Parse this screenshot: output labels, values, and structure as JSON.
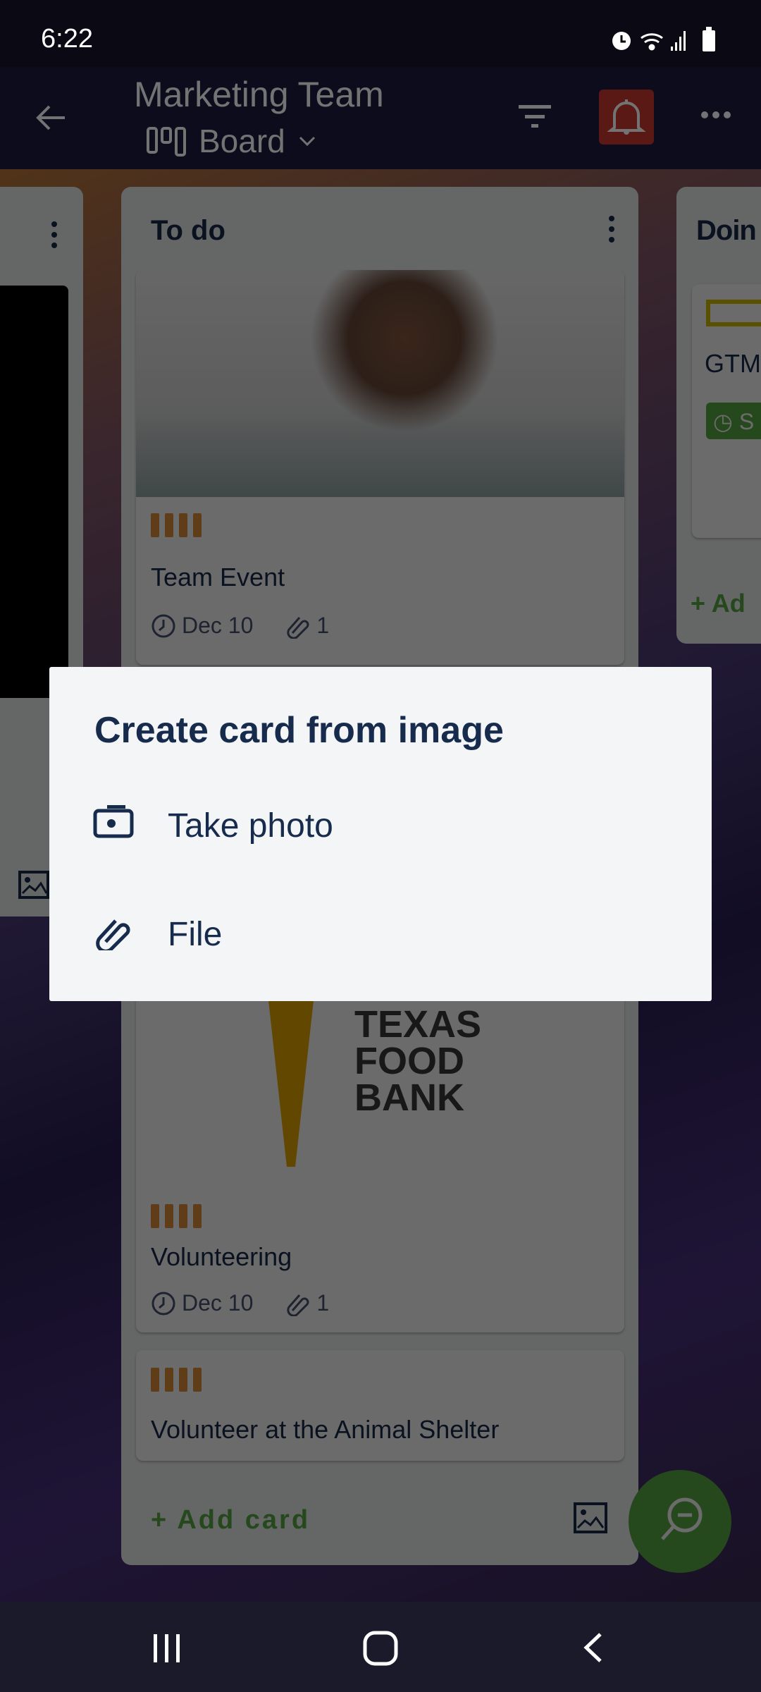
{
  "status_bar": {
    "time": "6:22",
    "icons": [
      "alarm-icon",
      "wifi-icon",
      "signal-icon",
      "battery-icon"
    ]
  },
  "app_bar": {
    "title": "Marketing Team",
    "view": "Board",
    "icons": [
      "back-arrow-icon",
      "board-icon",
      "chevron-down-icon",
      "filter-icon",
      "bell-icon",
      "more-icon"
    ],
    "bell_color": "#c9372c"
  },
  "lists": [
    {
      "title": "To do",
      "cards": [
        {
          "title": "Team Event",
          "due": "Dec 10",
          "attachments": "1",
          "label_color": "#e2913a"
        },
        {
          "image_text": "TEXAS FOOD BANK",
          "title": "Volunteering",
          "due": "Dec 10",
          "attachments": "1",
          "label_color": "#e2913a"
        },
        {
          "title": "Volunteer at the Animal Shelter",
          "label_color": "#e2913a"
        }
      ],
      "add_card": "+ Add card"
    },
    {
      "title": "Doin",
      "cards": [
        {
          "title": "GTM",
          "badge": "S"
        }
      ],
      "add_card": "+ Ad"
    }
  ],
  "dialog": {
    "title": "Create card from image",
    "items": [
      {
        "label": "Take photo",
        "icon": "camera-icon"
      },
      {
        "label": "File",
        "icon": "paperclip-icon"
      }
    ]
  },
  "colors": {
    "accent_green": "#5aac44",
    "text": "#172b4d"
  }
}
